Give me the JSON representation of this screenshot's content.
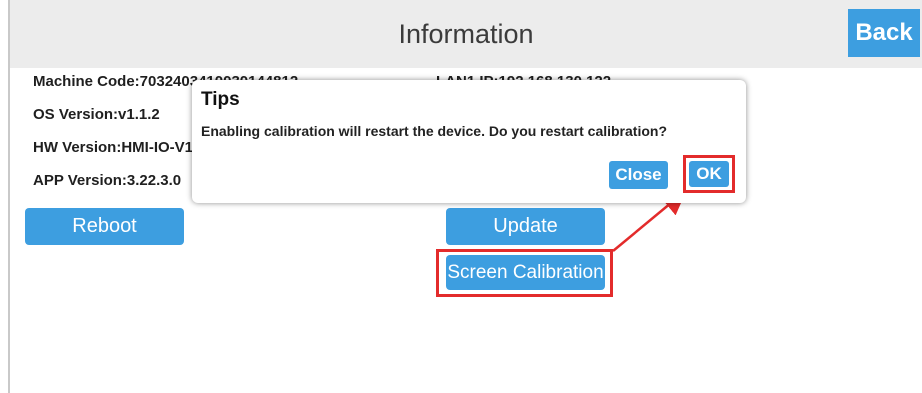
{
  "header": {
    "title": "Information",
    "back_label": "Back"
  },
  "info": {
    "machine_code": "Machine Code:7032403410030144812",
    "lan_ip": "LAN1 IP:192.168.130.122",
    "os_version": "OS Version:v1.1.2",
    "hw_version": "HW Version:HMI-IO-V1",
    "app_version": "APP Version:3.22.3.0"
  },
  "buttons": {
    "reboot": "Reboot",
    "update": "Update",
    "screen_calibration": "Screen Calibration"
  },
  "dialog": {
    "title": "Tips",
    "message": "Enabling calibration will restart the device. Do you restart calibration?",
    "close_label": "Close",
    "ok_label": "OK"
  },
  "colors": {
    "accent": "#3d9ee0",
    "highlight": "#e32b2b",
    "header_bg": "#ececec"
  }
}
